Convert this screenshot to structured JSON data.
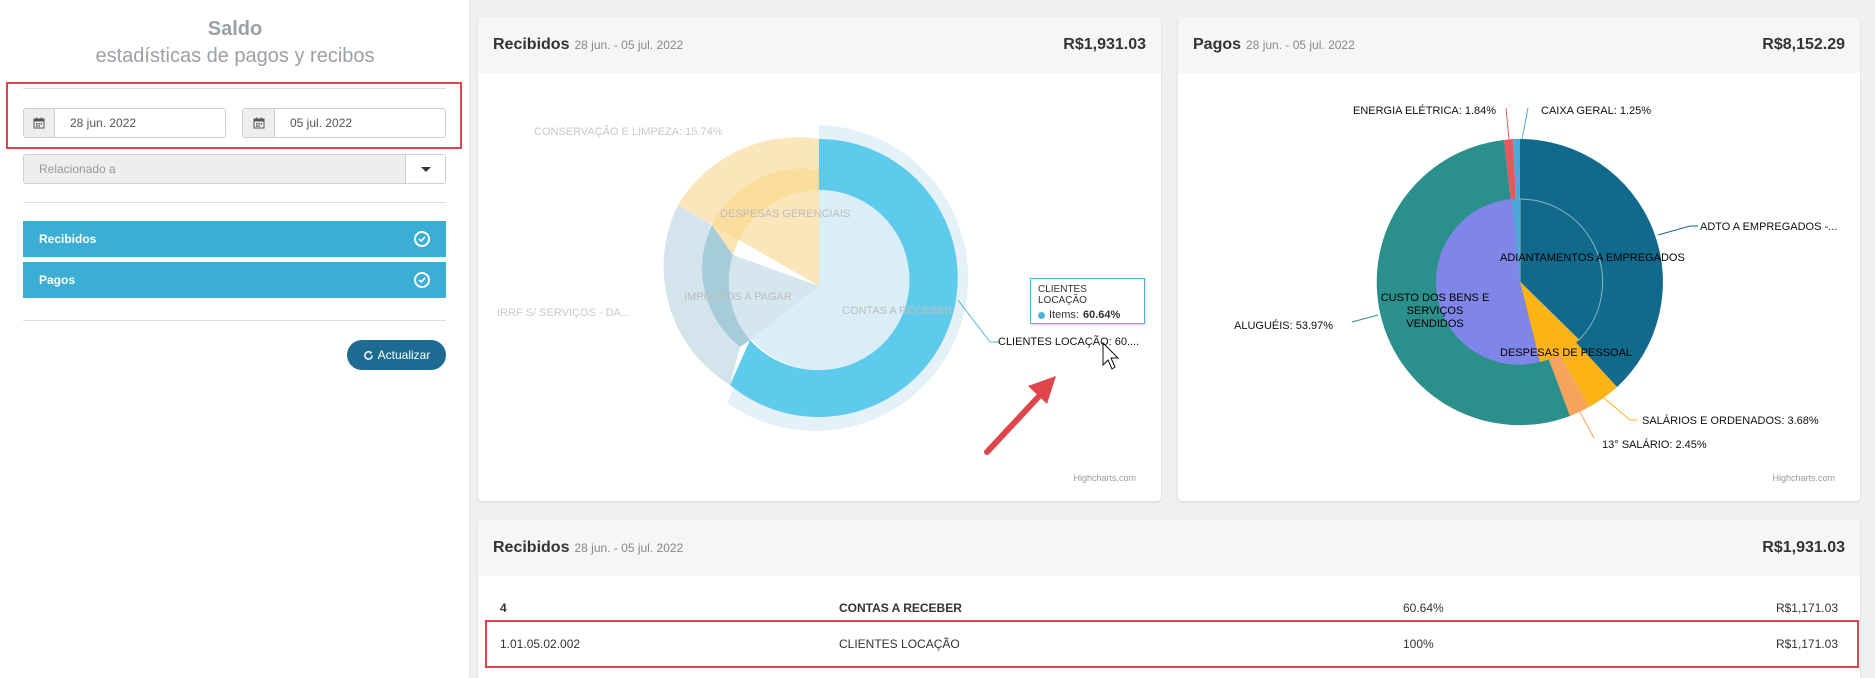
{
  "sidebar": {
    "title": "Saldo",
    "subtitle": "estadísticas de pagos y recibos",
    "date_from": "28 jun. 2022",
    "date_to": "05 jul. 2022",
    "related_placeholder": "Relacionado a",
    "toggles": [
      "Recibidos",
      "Pagos"
    ],
    "update_label": "Actualizar",
    "icons": [
      "calendar-icon",
      "check-circle-icon",
      "refresh-icon",
      "chevron-down-icon"
    ]
  },
  "recibidos_chart": {
    "title": "Recibidos",
    "range": "28 jun. - 05 jul. 2022",
    "amount": "R$1,931.03",
    "labels": {
      "conservacao": "CONSERVAÇÃO E LIMPEZA: 15.74%",
      "irrf": "IRRF S/ SERVIÇOS - DA...",
      "clientes": "CLIENTES LOCAÇÃO: 60...."
    },
    "inner": {
      "despesas": "DESPESAS GERENCIAIS",
      "impostos": "IMPOSTOS A PAGAR",
      "contas": "CONTAS A RECEBER"
    },
    "tooltip": {
      "title": "CLIENTES LOCAÇÃO",
      "series": "Items:",
      "value": "60.64%"
    },
    "credit": "Highcharts.com"
  },
  "pagos_chart": {
    "title": "Pagos",
    "range": "28 jun. - 05 jul. 2022",
    "amount": "R$8,152.29",
    "labels": {
      "energia": "ENERGIA ELÉTRICA: 1.84%",
      "caixa": "CAIXA GERAL: 1.25%",
      "adto": "ADTO A EMPREGADOS -...",
      "alugueis": "ALUGUÉIS: 53.97%",
      "salarios": "SALÁRIOS E ORDENADOS: 3.68%",
      "salario13": "13° SALÁRIO: 2.45%"
    },
    "inner": {
      "adiantamentos": "ADIANTAMENTOS A EMPREGADOS",
      "custo": "CUSTO DOS BENS E SERVIÇOS VENDIDOS",
      "pessoal": "DESPESAS DE PESSOAL"
    },
    "credit": "Highcharts.com",
    "colors": {
      "teal": "#2b8f8c",
      "navy": "#116a8c",
      "purple": "#8086e8",
      "orange": "#f7a35c",
      "gold": "#fbb315",
      "red": "#e4585e",
      "cyan": "#4ba9d9"
    }
  },
  "table_panel": {
    "title": "Recibidos",
    "range": "28 jun. - 05 jul. 2022",
    "amount": "R$1,931.03",
    "rows": [
      {
        "code": "4",
        "name": "CONTAS A RECEBER",
        "pct": "60.64%",
        "value": "R$1,171.03"
      },
      {
        "code": "1.01.05.02.002",
        "name": "CLIENTES LOCAÇÃO",
        "pct": "100%",
        "value": "R$1,171.03"
      }
    ]
  }
}
